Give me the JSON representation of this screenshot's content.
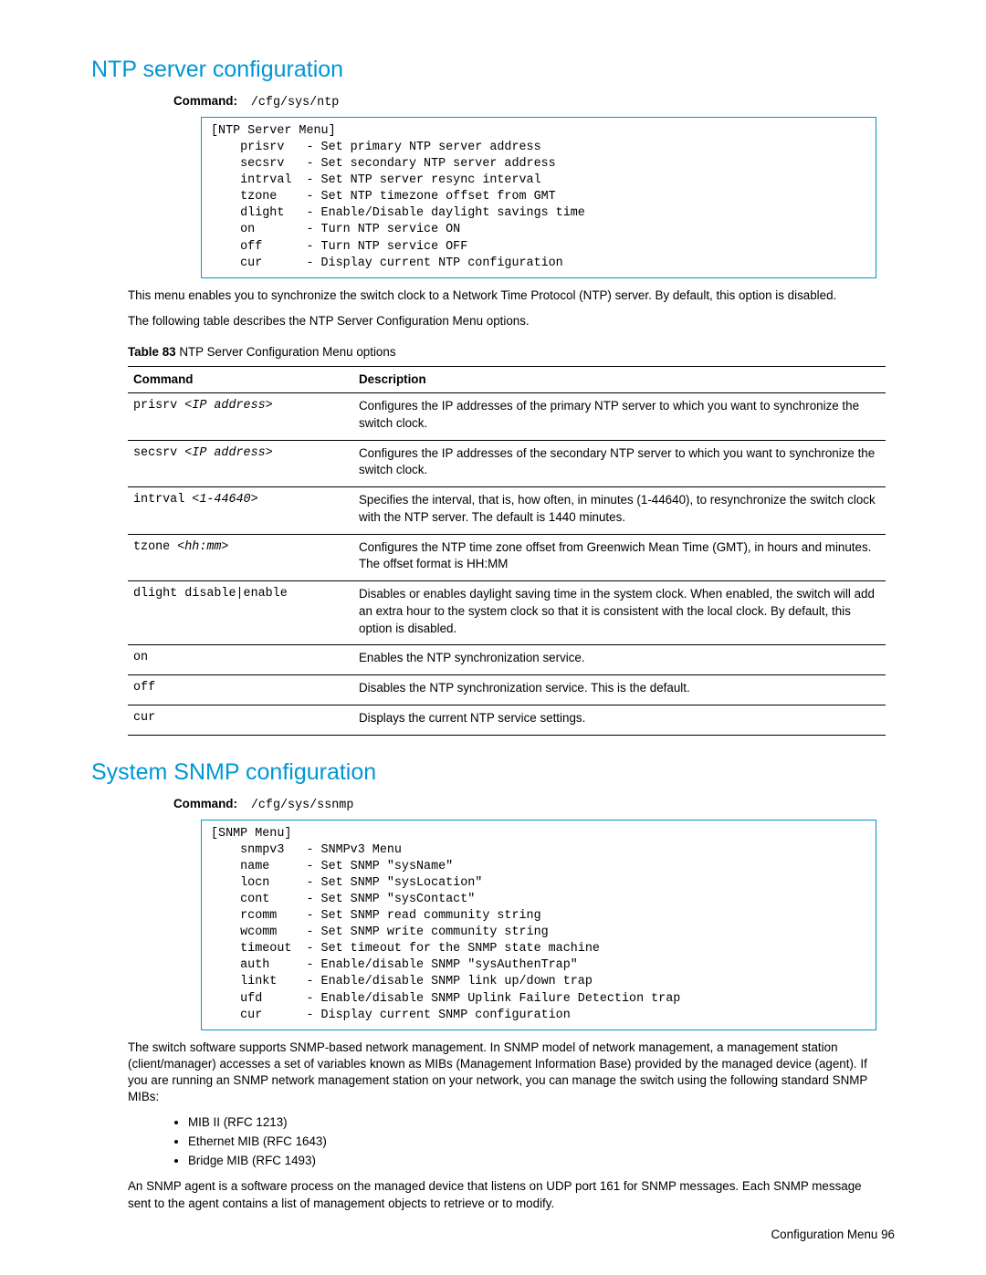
{
  "section1": {
    "title": "NTP server configuration",
    "command_label": "Command:",
    "command_path": "/cfg/sys/ntp",
    "menu_text": "[NTP Server Menu]\n    prisrv   - Set primary NTP server address\n    secsrv   - Set secondary NTP server address\n    intrval  - Set NTP server resync interval\n    tzone    - Set NTP timezone offset from GMT\n    dlight   - Enable/Disable daylight savings time\n    on       - Turn NTP service ON\n    off      - Turn NTP service OFF\n    cur      - Display current NTP configuration",
    "para1": "This menu enables you to synchronize the switch clock to a Network Time Protocol (NTP) server. By default, this option is disabled.",
    "para2": "The following table describes the NTP Server Configuration Menu options.",
    "table_caption_label": "Table 83",
    "table_caption_text": "  NTP Server Configuration Menu options",
    "table": {
      "col1": "Command",
      "col2": "Description",
      "rows": [
        {
          "cmd": "prisrv ",
          "arg": "<IP address>",
          "desc": "Configures the IP addresses of the primary NTP server to which you want to synchronize the switch clock."
        },
        {
          "cmd": "secsrv ",
          "arg": "<IP address>",
          "desc": "Configures the IP addresses of the secondary NTP server to which you want to synchronize the switch clock."
        },
        {
          "cmd": "intrval ",
          "arg": "<1-44640>",
          "desc": "Specifies the interval, that is, how often, in minutes (1-44640), to resynchronize the switch clock with the NTP server. The default is 1440 minutes."
        },
        {
          "cmd": "tzone ",
          "arg": "<hh:mm>",
          "desc": "Configures the NTP time zone offset from Greenwich Mean Time (GMT), in hours and minutes. The offset format is HH:MM"
        },
        {
          "cmd": "dlight disable|enable",
          "arg": "",
          "desc": "Disables or enables daylight saving time in the system clock. When enabled, the switch will add an extra hour to the system clock so that it is consistent with the local clock. By default, this option is disabled."
        },
        {
          "cmd": "on",
          "arg": "",
          "desc": "Enables the NTP synchronization service."
        },
        {
          "cmd": "off",
          "arg": "",
          "desc": "Disables the NTP synchronization service. This is the default."
        },
        {
          "cmd": "cur",
          "arg": "",
          "desc": "Displays the current NTP service settings."
        }
      ]
    }
  },
  "section2": {
    "title": "System SNMP configuration",
    "command_label": "Command:",
    "command_path": "/cfg/sys/ssnmp",
    "menu_text": "[SNMP Menu]\n    snmpv3   - SNMPv3 Menu\n    name     - Set SNMP \"sysName\"\n    locn     - Set SNMP \"sysLocation\"\n    cont     - Set SNMP \"sysContact\"\n    rcomm    - Set SNMP read community string\n    wcomm    - Set SNMP write community string\n    timeout  - Set timeout for the SNMP state machine\n    auth     - Enable/disable SNMP \"sysAuthenTrap\"\n    linkt    - Enable/disable SNMP link up/down trap\n    ufd      - Enable/disable SNMP Uplink Failure Detection trap\n    cur      - Display current SNMP configuration",
    "para1": "The switch software supports SNMP-based network management. In SNMP model of network management, a management station (client/manager) accesses a set of variables known as MIBs (Management Information Base) provided by the managed device (agent). If you are running an SNMP network management station on your network, you can manage the switch using the following standard SNMP MIBs:",
    "bullets": [
      "MIB II (RFC 1213)",
      "Ethernet MIB (RFC 1643)",
      "Bridge MIB (RFC 1493)"
    ],
    "para2": "An SNMP agent is a software process on the managed device that listens on UDP port 161 for SNMP messages. Each SNMP message sent to the agent contains a list of management objects to retrieve or to modify."
  },
  "footer": {
    "text": "Configuration Menu   96"
  }
}
